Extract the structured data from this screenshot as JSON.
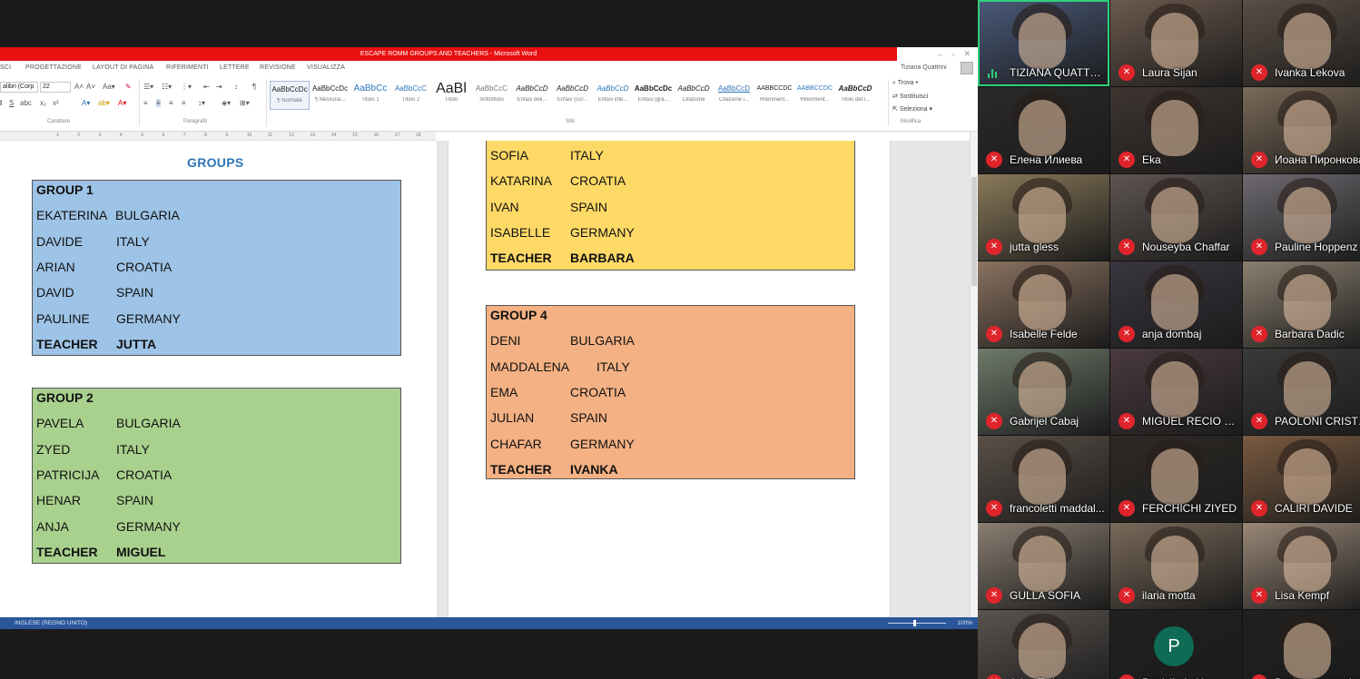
{
  "word": {
    "title": "ESCAPE ROMM GROUPS AND TEACHERS - Microsoft Word",
    "tabs": [
      "SCI",
      "PROGETTAZIONE",
      "LAYOUT DI PAGINA",
      "RIFERIMENTI",
      "LETTERE",
      "REVISIONE",
      "VISUALIZZA"
    ],
    "user": "Tiziana Quattrini",
    "font_name": "alibri (Corp",
    "font_size": "22",
    "styles": [
      {
        "preview": "AaBbCcDc",
        "name": "¶ Normale"
      },
      {
        "preview": "AaBbCcDc",
        "name": "¶ Nessuna..."
      },
      {
        "preview": "AaBbCc",
        "name": "Titolo 1"
      },
      {
        "preview": "AaBbCcC",
        "name": "Titolo 2"
      },
      {
        "preview": "AaBl",
        "name": "Titolo"
      },
      {
        "preview": "AaBbCcC",
        "name": "Sottotitolo"
      },
      {
        "preview": "AaBbCcD",
        "name": "Enfasi deli..."
      },
      {
        "preview": "AaBbCcD",
        "name": "Enfasi (cor..."
      },
      {
        "preview": "AaBbCcD",
        "name": "Enfasi inte..."
      },
      {
        "preview": "AaBbCcDc",
        "name": "Enfasi (gra..."
      },
      {
        "preview": "AaBbCcD",
        "name": "Citazione"
      },
      {
        "preview": "AaBbCcD",
        "name": "Citazione i..."
      },
      {
        "preview": "AABBCCDC",
        "name": "Riferiment..."
      },
      {
        "preview": "AABBCCDC",
        "name": "Riferiment..."
      },
      {
        "preview": "AaBbCcD",
        "name": "Titolo del l..."
      }
    ],
    "group_labels": {
      "font": "Carattere",
      "paragraph": "Paragrafo",
      "styles": "Stili",
      "edit": "Modifica"
    },
    "edit_items": [
      "Trova ▾",
      "Sostituisci",
      "Seleziona ▾"
    ],
    "ruler_numbers": [
      "1",
      "2",
      "3",
      "4",
      "5",
      "6",
      "7",
      "8",
      "9",
      "10",
      "11",
      "12",
      "13",
      "14",
      "15",
      "16",
      "17",
      "18"
    ],
    "status_language": "INGLESE (REGNO UNITO)",
    "zoom": "100%"
  },
  "document": {
    "heading": "GROUPS",
    "groups": [
      {
        "title": "GROUP 1",
        "color": "#9dc3e6",
        "rows": [
          {
            "name": "EKATERINA",
            "country": "BULGARIA"
          },
          {
            "name": "DAVIDE",
            "country": "ITALY"
          },
          {
            "name": "ARIAN",
            "country": "CROATIA"
          },
          {
            "name": "DAVID",
            "country": "SPAIN"
          },
          {
            "name": "PAULINE",
            "country": "GERMANY"
          },
          {
            "name": "TEACHER",
            "country": "JUTTA",
            "bold": true
          }
        ]
      },
      {
        "title": "GROUP 2",
        "color": "#a9d18e",
        "rows": [
          {
            "name": "PAVELA",
            "country": "BULGARIA"
          },
          {
            "name": "ZYED",
            "country": "ITALY"
          },
          {
            "name": "PATRICIJA",
            "country": "CROATIA"
          },
          {
            "name": "HENAR",
            "country": "SPAIN"
          },
          {
            "name": "ANJA",
            "country": "GERMANY"
          },
          {
            "name": "TEACHER",
            "country": "MIGUEL",
            "bold": true
          }
        ]
      },
      {
        "title": "",
        "color": "#ffd966",
        "rows": [
          {
            "name": "SOFIA",
            "country": "ITALY"
          },
          {
            "name": "KATARINA",
            "country": "CROATIA"
          },
          {
            "name": "IVAN",
            "country": "SPAIN"
          },
          {
            "name": "ISABELLE",
            "country": "GERMANY"
          },
          {
            "name": "TEACHER",
            "country": "BARBARA",
            "bold": true
          }
        ]
      },
      {
        "title": "GROUP 4",
        "color": "#f4b183",
        "rows": [
          {
            "name": "DENI",
            "country": "BULGARIA"
          },
          {
            "name": "MADDALENA",
            "country": "ITALY"
          },
          {
            "name": "EMA",
            "country": "CROATIA"
          },
          {
            "name": "JULIAN",
            "country": "SPAIN"
          },
          {
            "name": "CHAFAR",
            "country": "GERMANY"
          },
          {
            "name": "TEACHER",
            "country": "IVANKA",
            "bold": true
          }
        ]
      }
    ]
  },
  "participants": [
    {
      "name": "TIZIANA QUATTRI...",
      "muted": false,
      "active": true,
      "bg": "#4a5a7a"
    },
    {
      "name": "Laura Sijan",
      "muted": true,
      "bg": "#6b5a4e"
    },
    {
      "name": "Ivanka Lekova",
      "muted": true,
      "bg": "#5a4e45"
    },
    {
      "name": "Елена Илиева",
      "muted": true,
      "bg": "#2a2a2a"
    },
    {
      "name": "Eka",
      "muted": true,
      "bg": "#3e3530"
    },
    {
      "name": "Иоана Пиронкова",
      "muted": true,
      "bg": "#7a6a58"
    },
    {
      "name": "jutta gless",
      "muted": true,
      "bg": "#8a7a5a"
    },
    {
      "name": "Nouseyba Chaffar",
      "muted": true,
      "bg": "#5e5550"
    },
    {
      "name": "Pauline Hoppenz",
      "muted": true,
      "bg": "#6e6a70"
    },
    {
      "name": "Isabelle Felde",
      "muted": true,
      "bg": "#8a7260"
    },
    {
      "name": "anja dombaj",
      "muted": true,
      "bg": "#3a3640"
    },
    {
      "name": "Barbara Dadic",
      "muted": true,
      "bg": "#8a8070"
    },
    {
      "name": "Gabrijel Cabaj",
      "muted": true,
      "bg": "#6e7a6a"
    },
    {
      "name": "MIGUEL RECIO SE...",
      "muted": true,
      "bg": "#4a3a40"
    },
    {
      "name": "PAOLONI CRISTIA...",
      "muted": true,
      "bg": "#3a3a3a"
    },
    {
      "name": "francoletti maddal...",
      "muted": true,
      "bg": "#5a5048"
    },
    {
      "name": "FERCHICHI ZIYED",
      "muted": true,
      "bg": "#2e2a26"
    },
    {
      "name": "CALIRI DAVIDE",
      "muted": true,
      "bg": "#7a5a40"
    },
    {
      "name": "GULLA SOFIA",
      "muted": true,
      "bg": "#8a7e72"
    },
    {
      "name": "ilaria motta",
      "muted": true,
      "bg": "#7a6a5a"
    },
    {
      "name": "Lisa Kempf",
      "muted": true,
      "bg": "#9a8878"
    },
    {
      "name": "Arian Toth",
      "muted": true,
      "bg": "#5a5450"
    },
    {
      "name": "Patricija Lukic",
      "muted": true,
      "bg": "#202020",
      "initial": "P",
      "initial_color": "#0f6b55"
    },
    {
      "name": "Pavi parvanovska",
      "muted": true,
      "bg": "#202020"
    }
  ]
}
